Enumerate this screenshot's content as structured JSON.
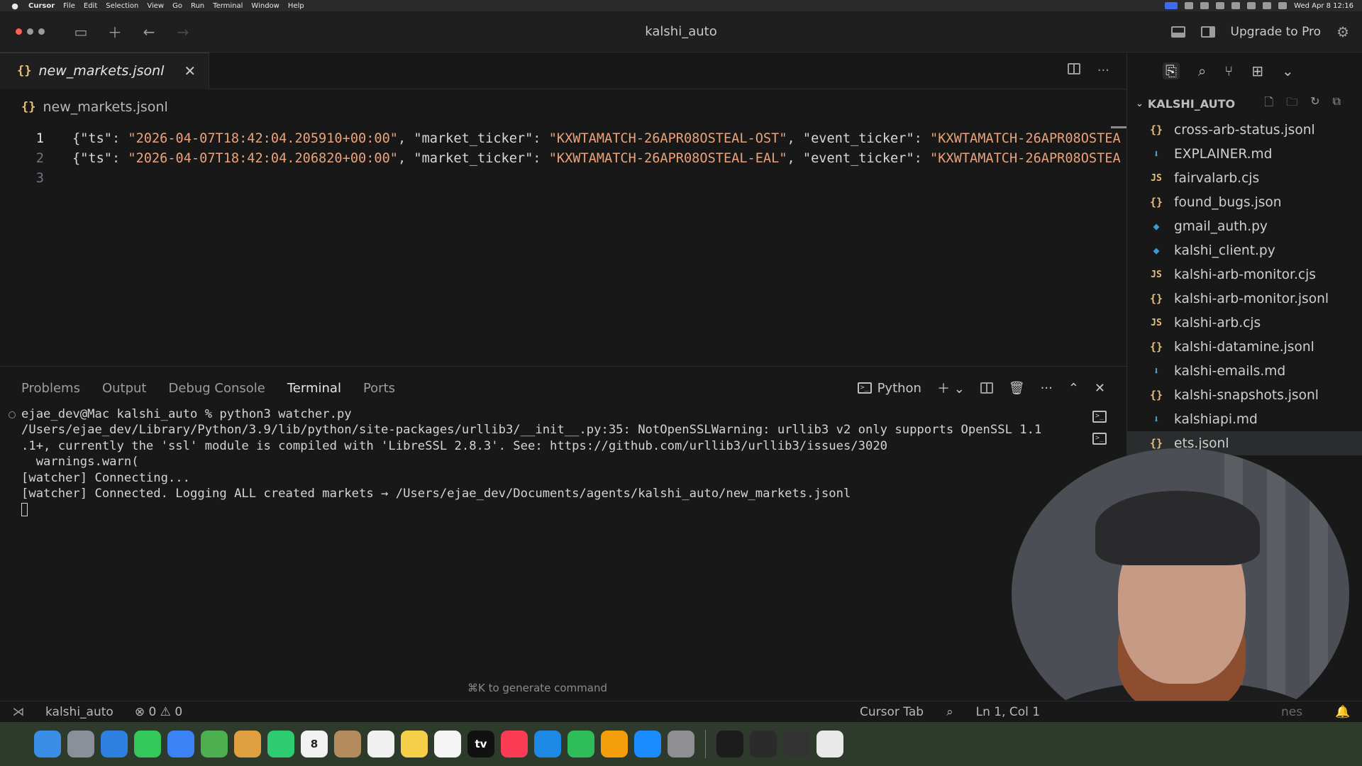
{
  "menubar": {
    "app_name": "Cursor",
    "items": [
      "File",
      "Edit",
      "Selection",
      "View",
      "Go",
      "Run",
      "Terminal",
      "Window",
      "Help"
    ],
    "clock": "Wed Apr 8  12:16"
  },
  "window": {
    "title": "kalshi_auto",
    "upgrade_label": "Upgrade to Pro"
  },
  "editor": {
    "tab_label": "new_markets.jsonl",
    "breadcrumb": "new_markets.jsonl",
    "line_numbers": [
      "1",
      "2",
      "3"
    ],
    "lines": [
      {
        "k1": "{\"ts\"",
        "v1": "\"2026-04-07T18:42:04.205910+00:00\"",
        "k2": "\"market_ticker\"",
        "v2": "\"KXWTAMATCH-26APR08OSTEAL-OST\"",
        "k3": "\"event_ticker\"",
        "v3": "\"KXWTAMATCH-26APR08OSTEA"
      },
      {
        "k1": "{\"ts\"",
        "v1": "\"2026-04-07T18:42:04.206820+00:00\"",
        "k2": "\"market_ticker\"",
        "v2": "\"KXWTAMATCH-26APR08OSTEAL-EAL\"",
        "k3": "\"event_ticker\"",
        "v3": "\"KXWTAMATCH-26APR08OSTEA"
      }
    ]
  },
  "panel": {
    "tabs": [
      "Problems",
      "Output",
      "Debug Console",
      "Terminal",
      "Ports"
    ],
    "active_tab": "Terminal",
    "shell_label": "Python",
    "terminal_lines": [
      "ejae_dev@Mac kalshi_auto % python3 watcher.py",
      "/Users/ejae_dev/Library/Python/3.9/lib/python/site-packages/urllib3/__init__.py:35: NotOpenSSLWarning: urllib3 v2 only supports OpenSSL 1.1",
      ".1+, currently the 'ssl' module is compiled with 'LibreSSL 2.8.3'. See: https://github.com/urllib3/urllib3/issues/3020",
      "  warnings.warn(",
      "[watcher] Connecting...",
      "[watcher] Connected. Logging ALL created markets → /Users/ejae_dev/Documents/agents/kalshi_auto/new_markets.jsonl"
    ],
    "generate_hint": "⌘K to generate command"
  },
  "explorer": {
    "root": "KALSHI_AUTO",
    "files": [
      {
        "name": "cross-arb-status.jsonl",
        "icon": "json-icon"
      },
      {
        "name": "EXPLAINER.md",
        "icon": "markdown-icon"
      },
      {
        "name": "fairvalarb.cjs",
        "icon": "js-icon"
      },
      {
        "name": "found_bugs.json",
        "icon": "json-icon"
      },
      {
        "name": "gmail_auth.py",
        "icon": "python-icon"
      },
      {
        "name": "kalshi_client.py",
        "icon": "python-icon"
      },
      {
        "name": "kalshi-arb-monitor.cjs",
        "icon": "js-icon"
      },
      {
        "name": "kalshi-arb-monitor.jsonl",
        "icon": "json-icon"
      },
      {
        "name": "kalshi-arb.cjs",
        "icon": "js-icon"
      },
      {
        "name": "kalshi-datamine.jsonl",
        "icon": "json-icon"
      },
      {
        "name": "kalshi-emails.md",
        "icon": "markdown-icon"
      },
      {
        "name": "kalshi-snapshots.jsonl",
        "icon": "json-icon"
      },
      {
        "name": "kalshiapi.md",
        "icon": "markdown-icon"
      },
      {
        "name": "ets.jsonl",
        "icon": "json-icon"
      }
    ],
    "selected_index": 13
  },
  "statusbar": {
    "folder": "kalshi_auto",
    "problems": "⊗ 0 ⚠ 0",
    "cursor_tab": "Cursor Tab",
    "position": "Ln 1, Col 1",
    "partial": "nes"
  },
  "dock": {
    "apps": [
      {
        "name": "finder",
        "color": "#3a8ee6"
      },
      {
        "name": "launchpad",
        "color": "#8a8f99"
      },
      {
        "name": "safari",
        "color": "#2d7fe0"
      },
      {
        "name": "messages",
        "color": "#34c759"
      },
      {
        "name": "mail",
        "color": "#3b82f6"
      },
      {
        "name": "maps",
        "color": "#4caf50"
      },
      {
        "name": "photos",
        "color": "#e0a040"
      },
      {
        "name": "facetime",
        "color": "#2ecc71"
      },
      {
        "name": "calendar",
        "color": "#f2f2f2",
        "text": "8"
      },
      {
        "name": "contacts",
        "color": "#b38b5d"
      },
      {
        "name": "reminders",
        "color": "#f0f0f0"
      },
      {
        "name": "notes",
        "color": "#f7d04a"
      },
      {
        "name": "freeform",
        "color": "#f5f5f5"
      },
      {
        "name": "tv",
        "color": "#111111",
        "text": "tv"
      },
      {
        "name": "music",
        "color": "#fa3d55"
      },
      {
        "name": "keynote",
        "color": "#1e88e5"
      },
      {
        "name": "numbers",
        "color": "#2ebd59"
      },
      {
        "name": "pages",
        "color": "#f59e0b"
      },
      {
        "name": "app-store",
        "color": "#1a8cff"
      },
      {
        "name": "system-settings",
        "color": "#8e8e93"
      },
      {
        "name": "terminal",
        "color": "#1c1c1c"
      },
      {
        "name": "cursor",
        "color": "#2b2b2b"
      },
      {
        "name": "activity-monitor",
        "color": "#333333"
      },
      {
        "name": "chrome",
        "color": "#e9e9e9"
      }
    ]
  },
  "colors": {
    "accent": "#3d6cf0",
    "json_icon": "#e5c07b",
    "string": "#e8a37c",
    "close_button": "#ff5f57"
  }
}
